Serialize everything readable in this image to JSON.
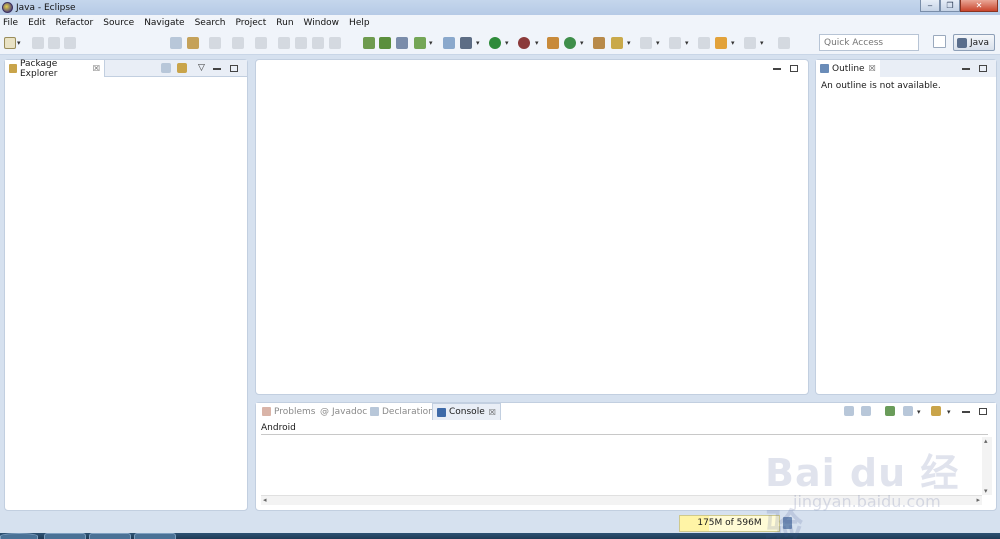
{
  "window": {
    "title": "Java - Eclipse",
    "minimize": "‒",
    "restore": "❐",
    "close": "✕"
  },
  "menu": [
    "File",
    "Edit",
    "Refactor",
    "Source",
    "Navigate",
    "Search",
    "Project",
    "Run",
    "Window",
    "Help"
  ],
  "toolbar": {
    "quick_access_placeholder": "Quick Access",
    "perspective_label": "Java"
  },
  "package_explorer": {
    "tab_label": "Package Explorer",
    "close": "☒"
  },
  "outline": {
    "tab_label": "Outline",
    "close": "☒",
    "message": "An outline is not available."
  },
  "bottom_tabs": [
    {
      "label": "Problems",
      "active": false
    },
    {
      "label": "Javadoc",
      "active": false
    },
    {
      "label": "Declaration",
      "active": false
    },
    {
      "label": "Console",
      "active": true
    }
  ],
  "console": {
    "name": "Android",
    "close": "☒"
  },
  "status": {
    "heap": "175M of 596M",
    "heap_fraction": 0.29
  },
  "watermark": {
    "main": "Bai du 经验",
    "sub": "jingyan.baidu.com"
  },
  "colors": {
    "accent": "#d6e1ef",
    "panel_border": "#c2cfe0",
    "heap_bg": "#fffbd6"
  }
}
